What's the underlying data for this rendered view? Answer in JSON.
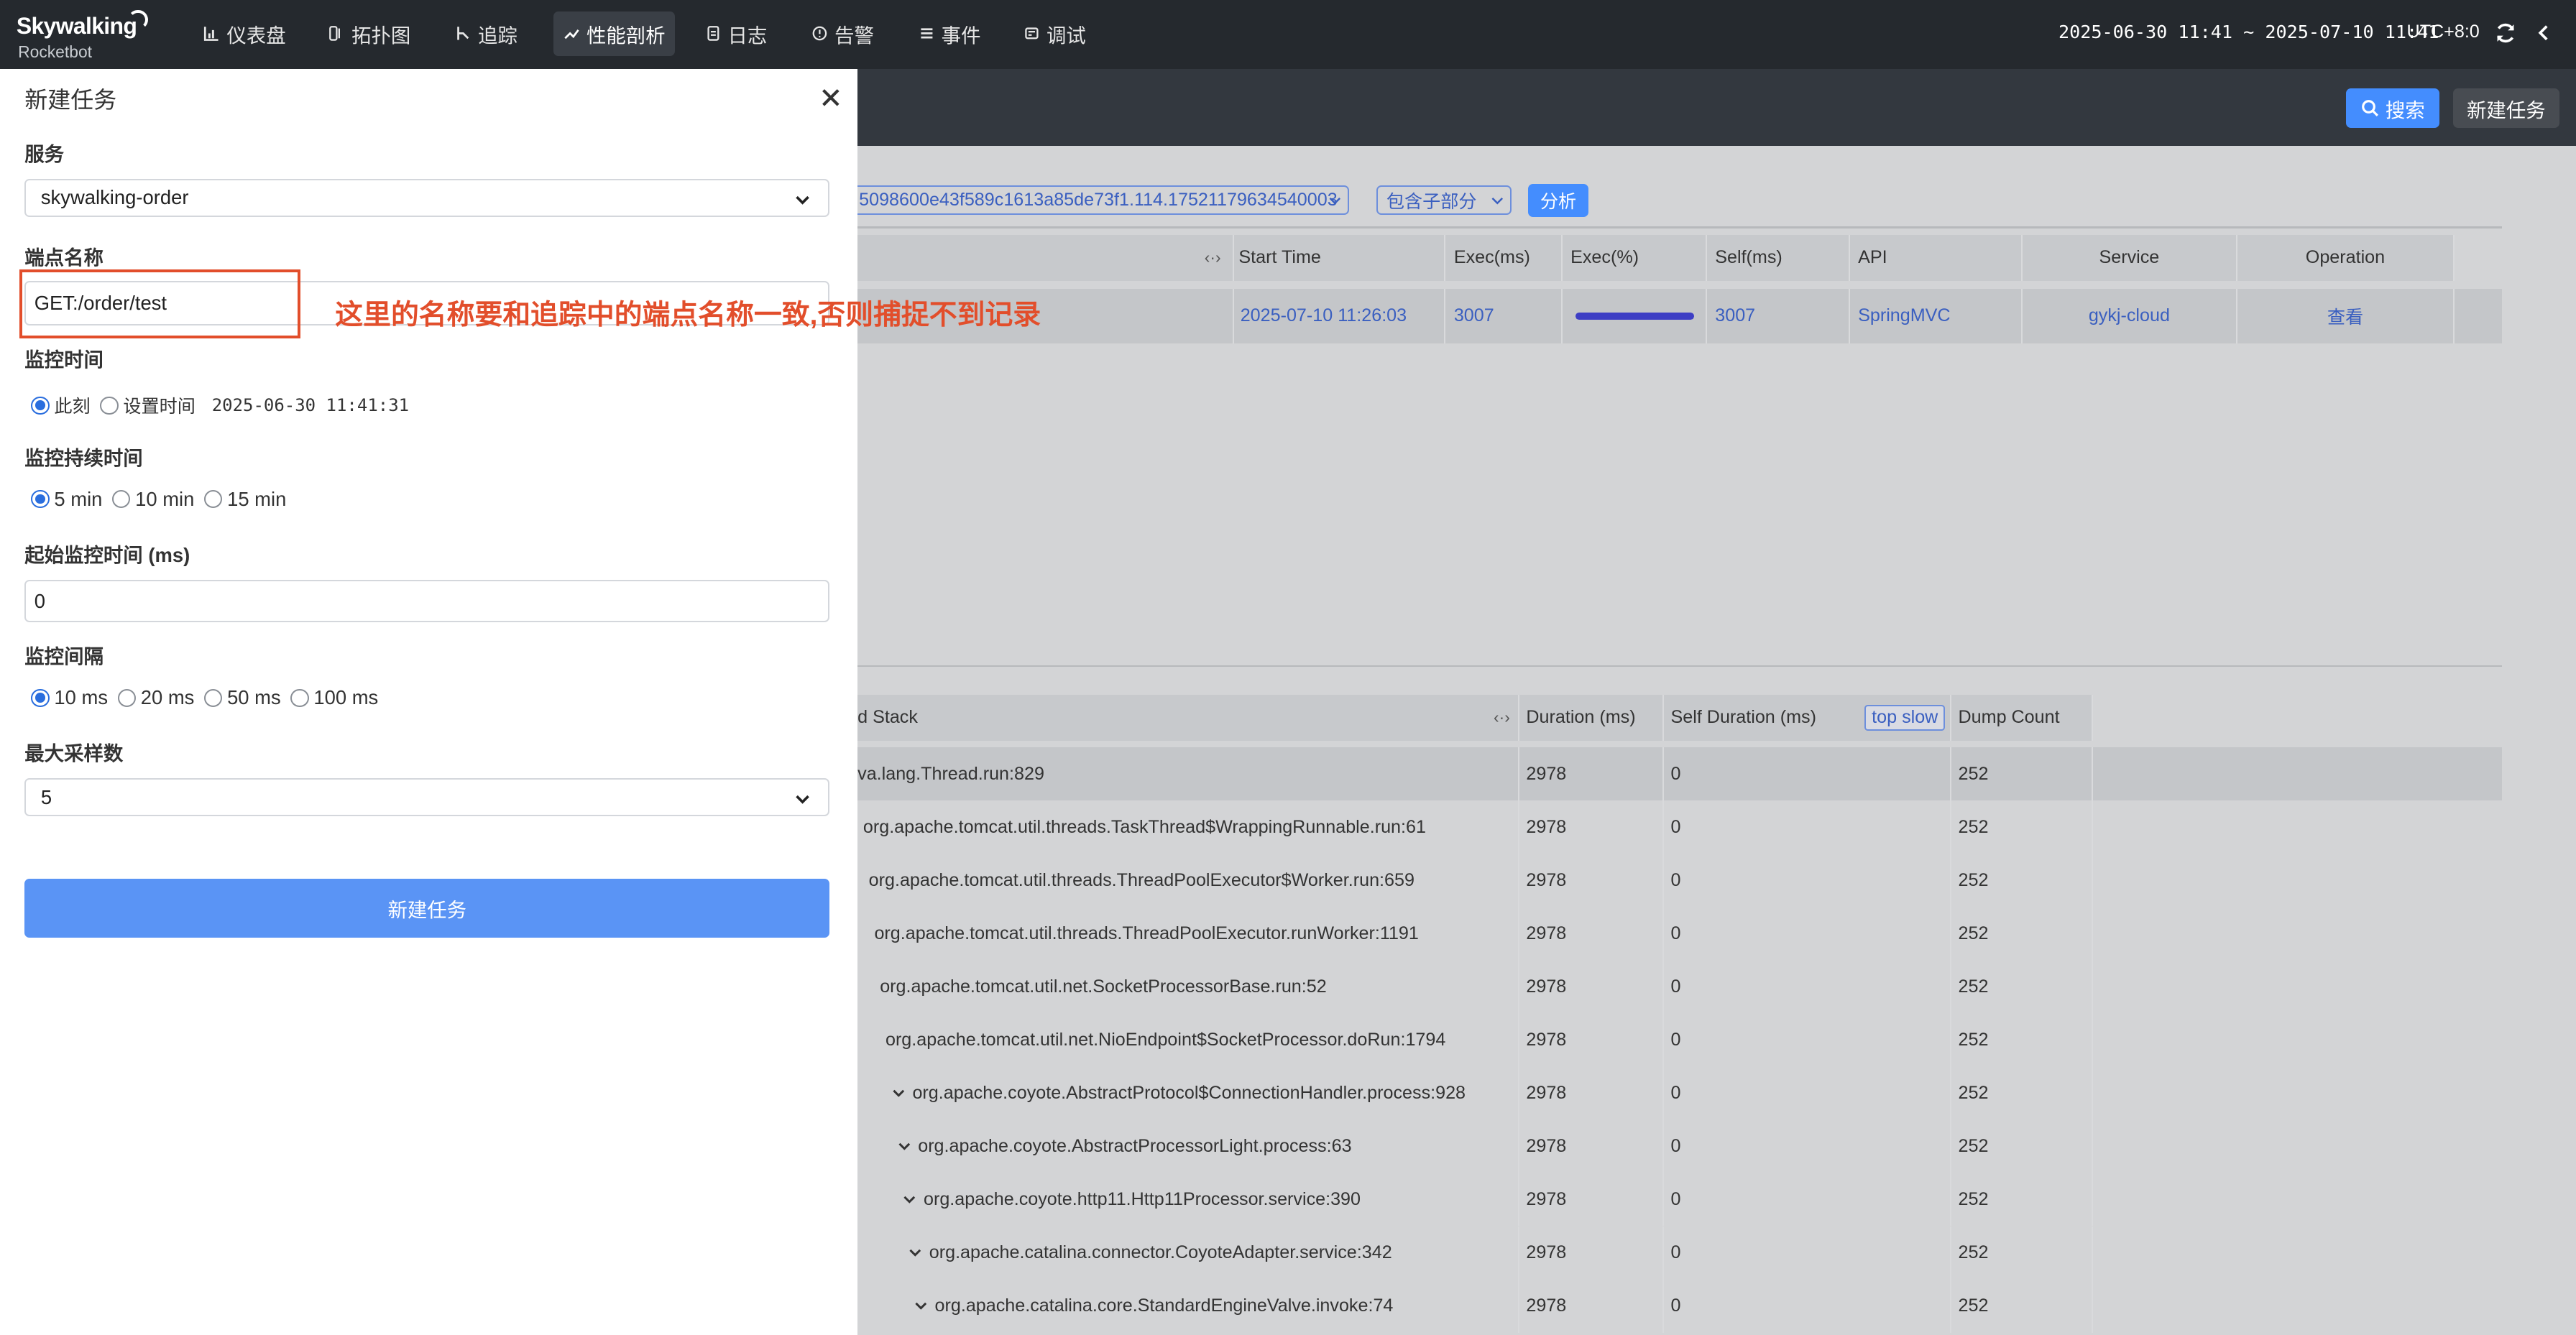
{
  "brand": {
    "name": "Skywalking",
    "sub": "Rocketbot"
  },
  "nav": {
    "tabs": [
      {
        "label": "仪表盘",
        "icon": "chart-icon"
      },
      {
        "label": "拓扑图",
        "icon": "topology-icon"
      },
      {
        "label": "追踪",
        "icon": "trace-icon"
      },
      {
        "label": "性能剖析",
        "icon": "profile-icon",
        "active": true
      },
      {
        "label": "日志",
        "icon": "log-icon"
      },
      {
        "label": "告警",
        "icon": "alarm-icon"
      },
      {
        "label": "事件",
        "icon": "event-icon"
      },
      {
        "label": "调试",
        "icon": "debug-icon"
      }
    ],
    "date_range": "2025-06-30 11:41 ~ 2025-07-10 11:41",
    "timezone": "UTC+8:0"
  },
  "toolbar": {
    "search_label": "搜索",
    "new_task_label": "新建任务"
  },
  "analysis": {
    "segment_value": "5098600e43f589c1613a85de73f1.114.17521179634540003",
    "child_option": "包含子部分",
    "analyze_label": "分析"
  },
  "segment_table": {
    "headers": [
      "Start Time",
      "Exec(ms)",
      "Exec(%)",
      "Self(ms)",
      "API",
      "Service",
      "Operation"
    ],
    "rows": [
      {
        "start_time": "2025-07-10 11:26:03",
        "exec_ms": "3007",
        "exec_pct": 1.0,
        "self_ms": "3007",
        "api": "SpringMVC",
        "service": "gykj-cloud",
        "operation": "查看"
      }
    ]
  },
  "stack_table": {
    "headers": [
      "d Stack",
      "Duration (ms)",
      "Self Duration (ms)",
      "Dump Count"
    ],
    "top_slow_label": "top slow",
    "rows": [
      {
        "name": "va.lang.Thread.run:829",
        "duration": "2978",
        "self": "0",
        "dump": "252",
        "caret": false
      },
      {
        "name": "org.apache.tomcat.util.threads.TaskThread$WrappingRunnable.run:61",
        "duration": "2978",
        "self": "0",
        "dump": "252",
        "caret": false
      },
      {
        "name": "org.apache.tomcat.util.threads.ThreadPoolExecutor$Worker.run:659",
        "duration": "2978",
        "self": "0",
        "dump": "252",
        "caret": false
      },
      {
        "name": "org.apache.tomcat.util.threads.ThreadPoolExecutor.runWorker:1191",
        "duration": "2978",
        "self": "0",
        "dump": "252",
        "caret": false
      },
      {
        "name": "org.apache.tomcat.util.net.SocketProcessorBase.run:52",
        "duration": "2978",
        "self": "0",
        "dump": "252",
        "caret": false
      },
      {
        "name": "org.apache.tomcat.util.net.NioEndpoint$SocketProcessor.doRun:1794",
        "duration": "2978",
        "self": "0",
        "dump": "252",
        "caret": false
      },
      {
        "name": "org.apache.coyote.AbstractProtocol$ConnectionHandler.process:928",
        "duration": "2978",
        "self": "0",
        "dump": "252",
        "caret": true
      },
      {
        "name": "org.apache.coyote.AbstractProcessorLight.process:63",
        "duration": "2978",
        "self": "0",
        "dump": "252",
        "caret": true
      },
      {
        "name": "org.apache.coyote.http11.Http11Processor.service:390",
        "duration": "2978",
        "self": "0",
        "dump": "252",
        "caret": true
      },
      {
        "name": "org.apache.catalina.connector.CoyoteAdapter.service:342",
        "duration": "2978",
        "self": "0",
        "dump": "252",
        "caret": true
      },
      {
        "name": "org.apache.catalina.core.StandardEngineValve.invoke:74",
        "duration": "2978",
        "self": "0",
        "dump": "252",
        "caret": true
      }
    ]
  },
  "drawer": {
    "title": "新建任务",
    "service_label": "服务",
    "service_value": "skywalking-order",
    "endpoint_label": "端点名称",
    "endpoint_value": "GET:/order/test",
    "annotation": "这里的名称要和追踪中的端点名称一致,否则捕捉不到记录",
    "monitor_time_label": "监控时间",
    "monitor_time_options": [
      "此刻",
      "设置时间"
    ],
    "monitor_time_value": "2025-06-30 11:41:31",
    "duration_label": "监控持续时间",
    "duration_options": [
      "5 min",
      "10 min",
      "15 min"
    ],
    "start_time_label": "起始监控时间 (ms)",
    "start_time_value": "0",
    "interval_label": "监控间隔",
    "interval_options": [
      "10 ms",
      "20 ms",
      "50 ms",
      "100 ms"
    ],
    "max_sample_label": "最大采样数",
    "max_sample_value": "5",
    "submit_label": "新建任务"
  },
  "colors": {
    "accent": "#448dfe",
    "nav_bg": "#25292e",
    "annotation": "#e24e2b"
  }
}
